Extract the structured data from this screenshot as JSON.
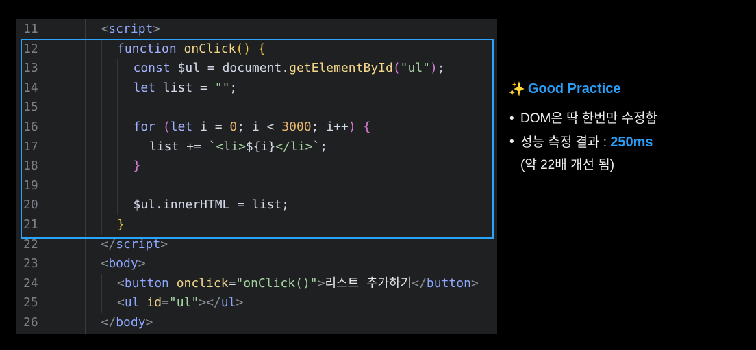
{
  "editor": {
    "lines": [
      {
        "num": "11",
        "tokens": [
          {
            "t": "<",
            "c": "punc"
          },
          {
            "t": "script",
            "c": "tag"
          },
          {
            "t": ">",
            "c": "punc"
          }
        ],
        "indent": 1
      },
      {
        "num": "12",
        "tokens": [
          {
            "t": "function ",
            "c": "kw"
          },
          {
            "t": "onClick",
            "c": "fn"
          },
          {
            "t": "() ",
            "c": "par1"
          },
          {
            "t": "{",
            "c": "par1"
          }
        ],
        "indent": 2
      },
      {
        "num": "13",
        "tokens": [
          {
            "t": "const ",
            "c": "kw"
          },
          {
            "t": "$ul",
            "c": "var"
          },
          {
            "t": " = ",
            "c": "var"
          },
          {
            "t": "document",
            "c": "var"
          },
          {
            "t": ".",
            "c": "var"
          },
          {
            "t": "getElementById",
            "c": "fn"
          },
          {
            "t": "(",
            "c": "par2"
          },
          {
            "t": "\"ul\"",
            "c": "str"
          },
          {
            "t": ")",
            "c": "par2"
          },
          {
            "t": ";",
            "c": "var"
          }
        ],
        "indent": 3
      },
      {
        "num": "14",
        "tokens": [
          {
            "t": "let ",
            "c": "kw"
          },
          {
            "t": "list",
            "c": "var"
          },
          {
            "t": " = ",
            "c": "var"
          },
          {
            "t": "\"\"",
            "c": "str"
          },
          {
            "t": ";",
            "c": "var"
          }
        ],
        "indent": 3
      },
      {
        "num": "15",
        "tokens": [],
        "indent": 3
      },
      {
        "num": "16",
        "tokens": [
          {
            "t": "for ",
            "c": "kw"
          },
          {
            "t": "(",
            "c": "par2"
          },
          {
            "t": "let ",
            "c": "kw"
          },
          {
            "t": "i",
            "c": "var"
          },
          {
            "t": " = ",
            "c": "var"
          },
          {
            "t": "0",
            "c": "num"
          },
          {
            "t": "; i < ",
            "c": "var"
          },
          {
            "t": "3000",
            "c": "num"
          },
          {
            "t": "; i++",
            "c": "var"
          },
          {
            "t": ") ",
            "c": "par2"
          },
          {
            "t": "{",
            "c": "par2"
          }
        ],
        "indent": 3
      },
      {
        "num": "17",
        "tokens": [
          {
            "t": "list",
            "c": "var"
          },
          {
            "t": " += ",
            "c": "var"
          },
          {
            "t": "`<li>",
            "c": "str"
          },
          {
            "t": "${i}",
            "c": "var"
          },
          {
            "t": "</li>`",
            "c": "str"
          },
          {
            "t": ";",
            "c": "var"
          }
        ],
        "indent": 4
      },
      {
        "num": "18",
        "tokens": [
          {
            "t": "}",
            "c": "par2"
          }
        ],
        "indent": 3
      },
      {
        "num": "19",
        "tokens": [],
        "indent": 3
      },
      {
        "num": "20",
        "tokens": [
          {
            "t": "$ul",
            "c": "var"
          },
          {
            "t": ".",
            "c": "var"
          },
          {
            "t": "innerHTML",
            "c": "var"
          },
          {
            "t": " = ",
            "c": "var"
          },
          {
            "t": "list",
            "c": "var"
          },
          {
            "t": ";",
            "c": "var"
          }
        ],
        "indent": 3
      },
      {
        "num": "21",
        "tokens": [
          {
            "t": "}",
            "c": "par1"
          }
        ],
        "indent": 2
      },
      {
        "num": "22",
        "tokens": [
          {
            "t": "</",
            "c": "punc"
          },
          {
            "t": "script",
            "c": "tag"
          },
          {
            "t": ">",
            "c": "punc"
          }
        ],
        "indent": 1
      },
      {
        "num": "23",
        "tokens": [
          {
            "t": "<",
            "c": "punc"
          },
          {
            "t": "body",
            "c": "tag"
          },
          {
            "t": ">",
            "c": "punc"
          }
        ],
        "indent": 1
      },
      {
        "num": "24",
        "tokens": [
          {
            "t": "<",
            "c": "punc"
          },
          {
            "t": "button ",
            "c": "tag"
          },
          {
            "t": "onclick",
            "c": "attr"
          },
          {
            "t": "=",
            "c": "var"
          },
          {
            "t": "\"onClick()\"",
            "c": "str"
          },
          {
            "t": ">",
            "c": "punc"
          },
          {
            "t": "리스트 추가하기",
            "c": "txt"
          },
          {
            "t": "</",
            "c": "punc"
          },
          {
            "t": "button",
            "c": "tag"
          },
          {
            "t": ">",
            "c": "punc"
          }
        ],
        "indent": 2
      },
      {
        "num": "25",
        "tokens": [
          {
            "t": "<",
            "c": "punc"
          },
          {
            "t": "ul ",
            "c": "tag"
          },
          {
            "t": "id",
            "c": "attr"
          },
          {
            "t": "=",
            "c": "var"
          },
          {
            "t": "\"ul\"",
            "c": "str"
          },
          {
            "t": "></",
            "c": "punc"
          },
          {
            "t": "ul",
            "c": "tag"
          },
          {
            "t": ">",
            "c": "punc"
          }
        ],
        "indent": 2
      },
      {
        "num": "26",
        "tokens": [
          {
            "t": "</",
            "c": "punc"
          },
          {
            "t": "body",
            "c": "tag"
          },
          {
            "t": ">",
            "c": "punc"
          }
        ],
        "indent": 1
      }
    ]
  },
  "panel": {
    "sparkle": "✨",
    "title": "Good Practice",
    "bullet_dot": "•",
    "bullet1": "DOM은 딱 한번만 수정함",
    "bullet2_prefix": "성능 측정 결과 : ",
    "bullet2_value": "250ms",
    "bullet2_sub": "(약 22배 개선 됨)"
  },
  "colors": {
    "accent": "#2a9df4",
    "highlight_border": "#2aa3ff",
    "editor_bg": "#1f2022"
  }
}
